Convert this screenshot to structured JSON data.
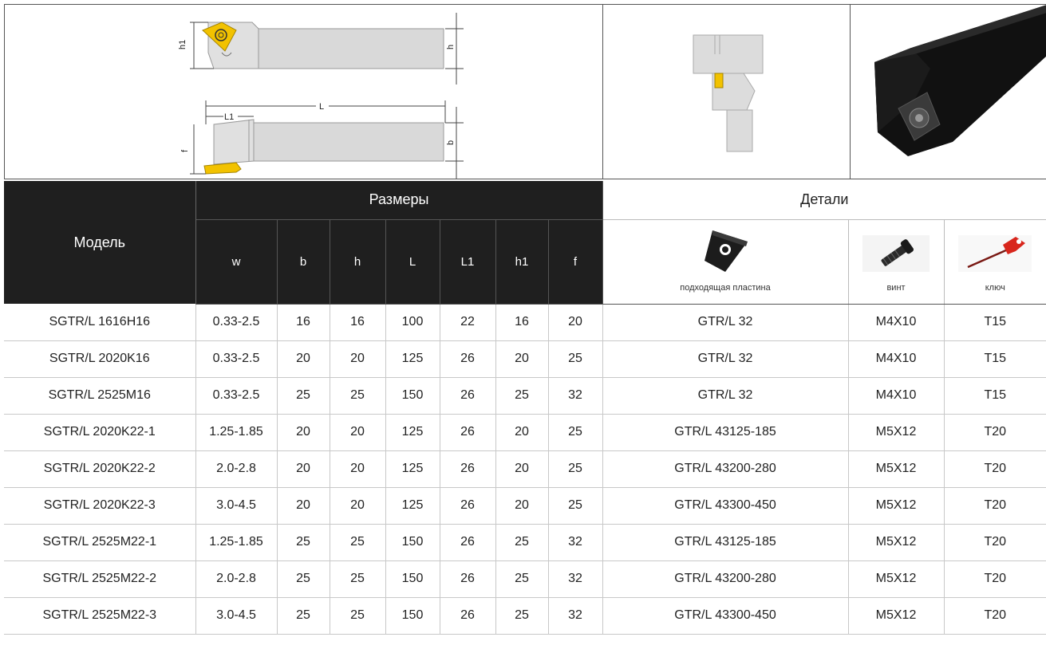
{
  "headers": {
    "model": "Модель",
    "dimensions": "Размеры",
    "details": "Детали",
    "columns": [
      "w",
      "b",
      "h",
      "L",
      "L1",
      "h1",
      "f"
    ],
    "parts": [
      "подходящая пластина",
      "винт",
      "ключ"
    ]
  },
  "drawing_labels": {
    "h1": "h1",
    "h": "h",
    "L": "L",
    "L1": "L1",
    "f": "f",
    "b": "b"
  },
  "rows": [
    {
      "model": "SGTR/L 1616H16",
      "w": "0.33-2.5",
      "b": "16",
      "h": "16",
      "L": "100",
      "L1": "22",
      "h1": "16",
      "f": "20",
      "insert": "GTR/L 32",
      "screw": "M4X10",
      "key": "T15"
    },
    {
      "model": "SGTR/L 2020K16",
      "w": "0.33-2.5",
      "b": "20",
      "h": "20",
      "L": "125",
      "L1": "26",
      "h1": "20",
      "f": "25",
      "insert": "GTR/L 32",
      "screw": "M4X10",
      "key": "T15"
    },
    {
      "model": "SGTR/L 2525M16",
      "w": "0.33-2.5",
      "b": "25",
      "h": "25",
      "L": "150",
      "L1": "26",
      "h1": "25",
      "f": "32",
      "insert": "GTR/L 32",
      "screw": "M4X10",
      "key": "T15"
    },
    {
      "model": "SGTR/L 2020K22-1",
      "w": "1.25-1.85",
      "b": "20",
      "h": "20",
      "L": "125",
      "L1": "26",
      "h1": "20",
      "f": "25",
      "insert": "GTR/L 43125-185",
      "screw": "M5X12",
      "key": "T20"
    },
    {
      "model": "SGTR/L 2020K22-2",
      "w": "2.0-2.8",
      "b": "20",
      "h": "20",
      "L": "125",
      "L1": "26",
      "h1": "20",
      "f": "25",
      "insert": "GTR/L 43200-280",
      "screw": "M5X12",
      "key": "T20"
    },
    {
      "model": "SGTR/L 2020K22-3",
      "w": "3.0-4.5",
      "b": "20",
      "h": "20",
      "L": "125",
      "L1": "26",
      "h1": "20",
      "f": "25",
      "insert": "GTR/L 43300-450",
      "screw": "M5X12",
      "key": "T20"
    },
    {
      "model": "SGTR/L 2525M22-1",
      "w": "1.25-1.85",
      "b": "25",
      "h": "25",
      "L": "150",
      "L1": "26",
      "h1": "25",
      "f": "32",
      "insert": "GTR/L 43125-185",
      "screw": "M5X12",
      "key": "T20"
    },
    {
      "model": "SGTR/L 2525M22-2",
      "w": "2.0-2.8",
      "b": "25",
      "h": "25",
      "L": "150",
      "L1": "26",
      "h1": "25",
      "f": "32",
      "insert": "GTR/L 43200-280",
      "screw": "M5X12",
      "key": "T20"
    },
    {
      "model": "SGTR/L 2525M22-3",
      "w": "3.0-4.5",
      "b": "25",
      "h": "25",
      "L": "150",
      "L1": "26",
      "h1": "25",
      "f": "32",
      "insert": "GTR/L 43300-450",
      "screw": "M5X12",
      "key": "T20"
    }
  ],
  "colors": {
    "header_dark": "#1f1f1f",
    "insert_yellow": "#f2c200",
    "holder_gray": "#d6d6d6",
    "key_red": "#d8261c"
  }
}
